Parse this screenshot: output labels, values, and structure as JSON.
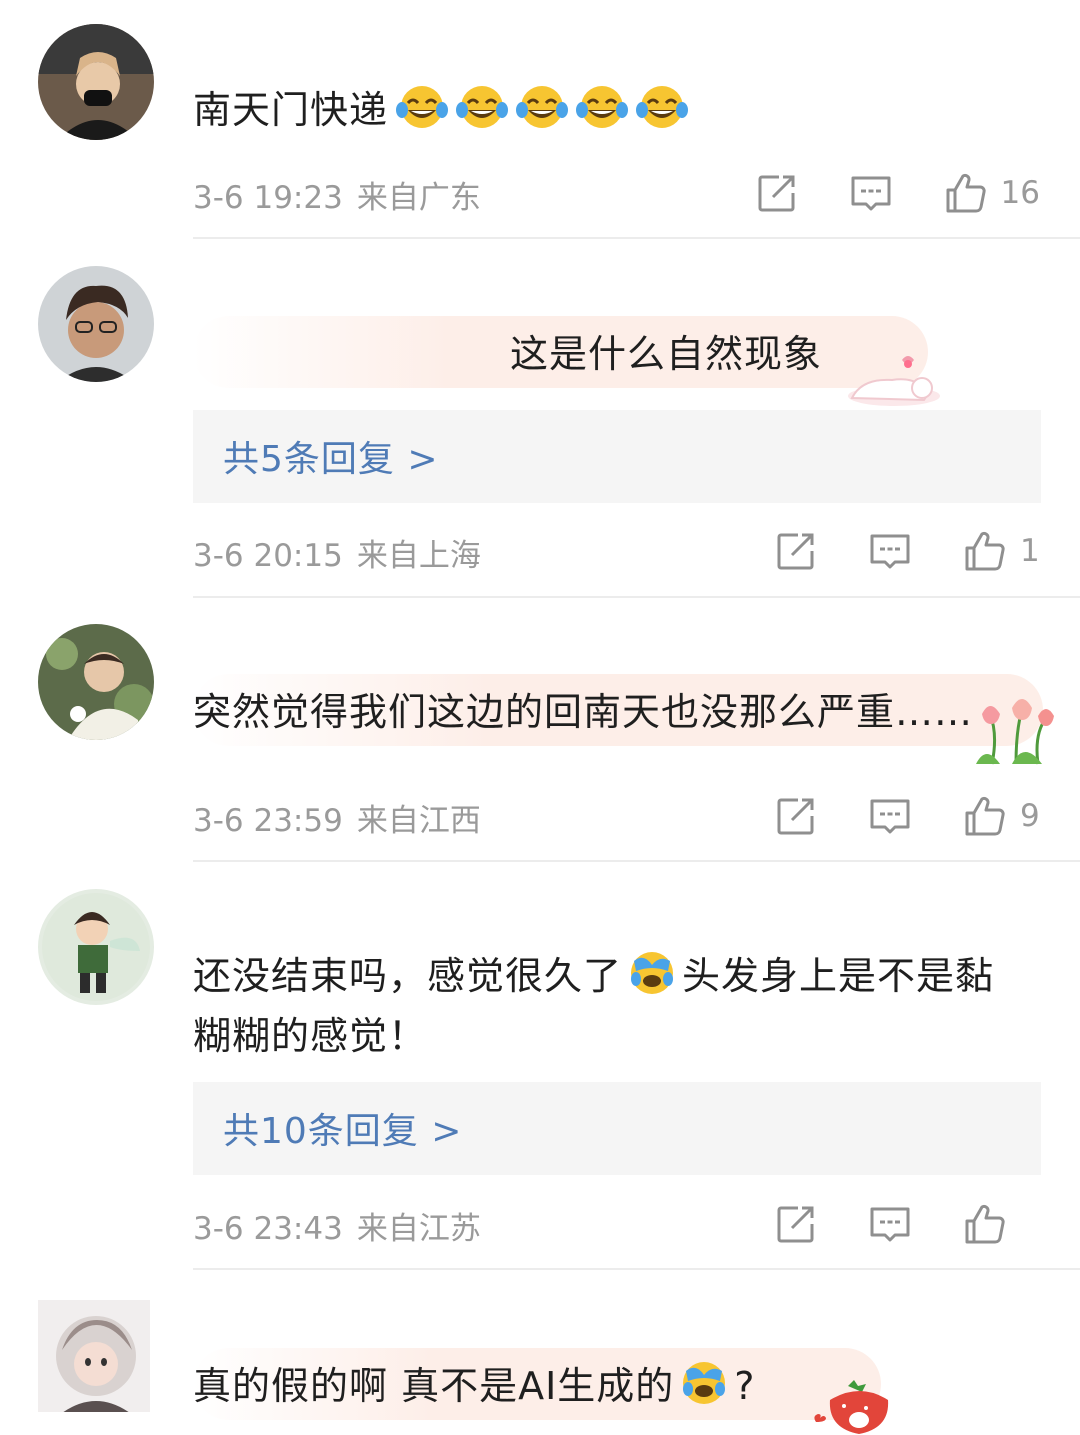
{
  "comments": [
    {
      "text": "南天门快递",
      "emojis": [
        "laughing-tears-emoji",
        "laughing-tears-emoji",
        "laughing-tears-emoji",
        "laughing-tears-emoji",
        "laughing-tears-emoji"
      ],
      "date": "3-6 19:23",
      "location": "来自广东",
      "likes": "16"
    },
    {
      "text": "这是什么自然现象",
      "replies_label": "共5条回复 >",
      "date": "3-6 20:15",
      "location": "来自上海",
      "likes": "1"
    },
    {
      "text": "突然觉得我们这边的回南天也没那么严重……",
      "date": "3-6 23:59",
      "location": "来自江西",
      "likes": "9"
    },
    {
      "text_part1": "还没结束吗，感觉很久了",
      "text_part2": "头发身上是不是黏糊糊的感觉！",
      "emoji": "crying-laughing-emoji",
      "replies_label": "共10条回复 >",
      "date": "3-6 23:43",
      "location": "来自江苏",
      "likes": ""
    },
    {
      "text_part1": "真的假的啊 真不是AI生成的",
      "text_part2": "?",
      "emoji": "crying-laughing-emoji"
    }
  ],
  "colors": {
    "reply_link": "#4f7bb6",
    "meta_text": "#9a9a9a",
    "reply_box_bg": "#f5f5f5",
    "bubble_bg": "#fdeee8",
    "divider": "#ececec"
  },
  "icons": [
    "repost-icon",
    "comment-icon",
    "like-icon"
  ]
}
